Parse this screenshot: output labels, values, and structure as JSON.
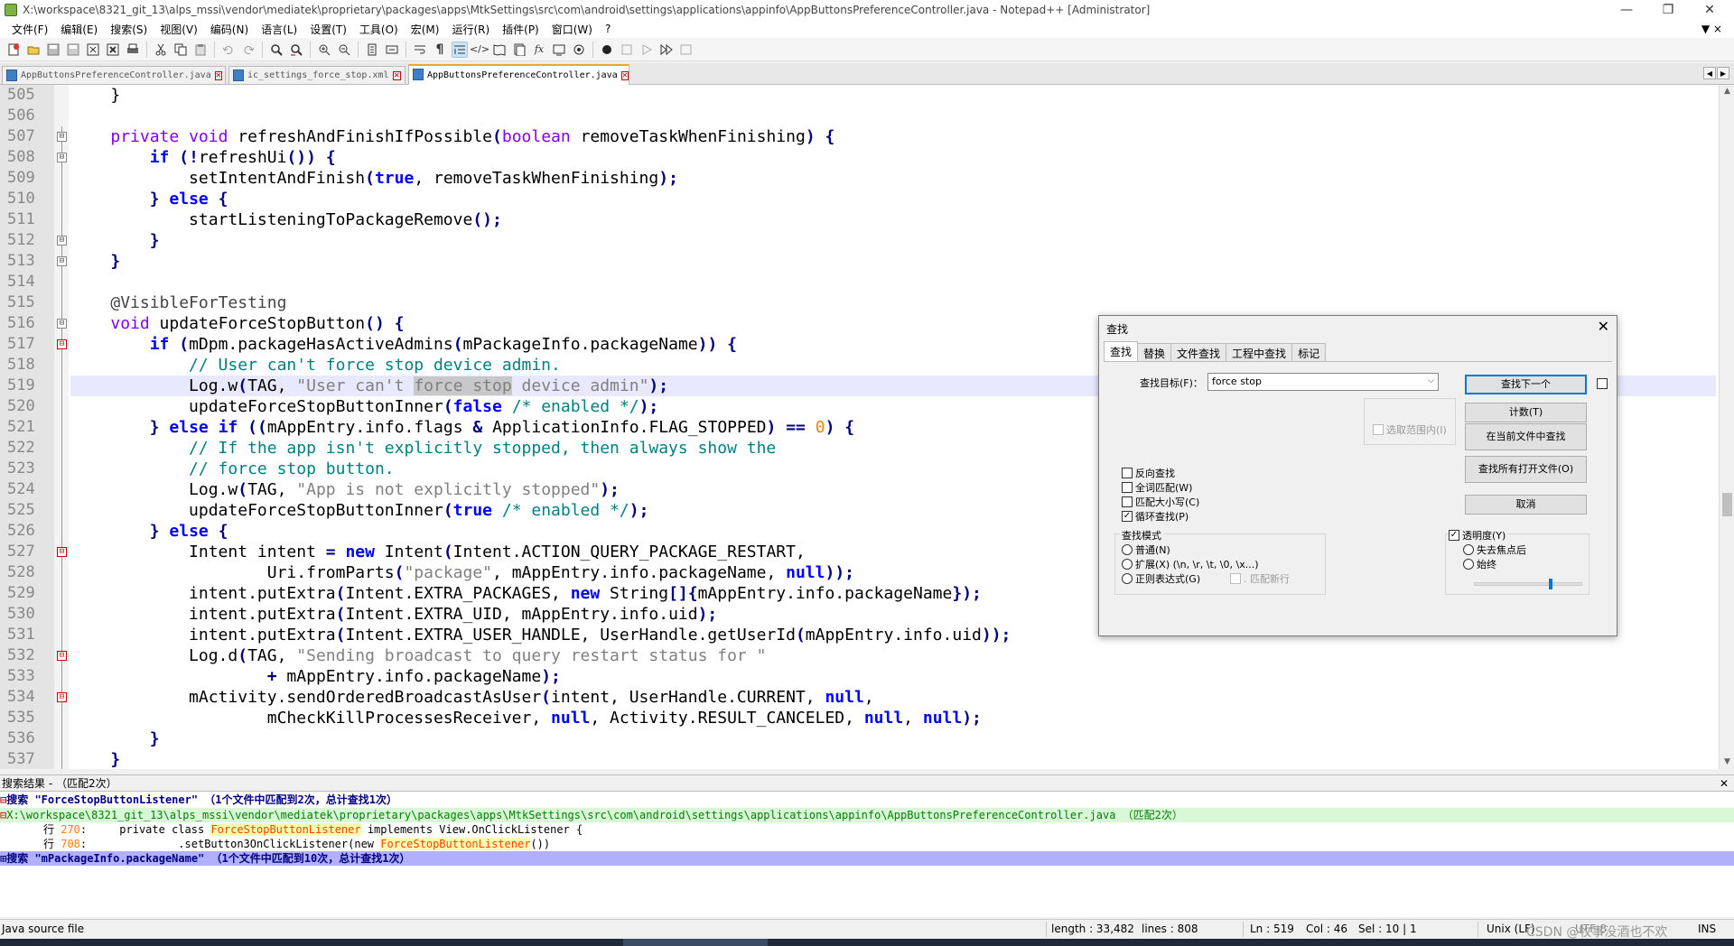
{
  "window": {
    "title": "X:\\workspace\\8321_git_13\\alps_mssi\\vendor\\mediatek\\proprietary\\packages\\apps\\MtkSettings\\src\\com\\android\\settings\\applications\\appinfo\\AppButtonsPreferenceController.java - Notepad++ [Administrator]",
    "min": "—",
    "max": "❐",
    "close": "✕"
  },
  "menu": [
    "文件(F)",
    "编辑(E)",
    "搜索(S)",
    "视图(V)",
    "编码(N)",
    "语言(L)",
    "设置(T)",
    "工具(O)",
    "宏(M)",
    "运行(R)",
    "插件(P)",
    "窗口(W)",
    "?"
  ],
  "menu_right": "▼ ×",
  "tabs": [
    {
      "label": "AppButtonsPreferenceController.java",
      "close": "✕"
    },
    {
      "label": "ic_settings_force_stop.xml",
      "close": "✕"
    },
    {
      "label": "AppButtonsPreferenceController.java",
      "close": "✕"
    }
  ],
  "tabnav": {
    "left": "◀",
    "right": "▶",
    "close": "✕"
  },
  "editor": {
    "lines": [
      {
        "n": "505"
      },
      {
        "n": "506"
      },
      {
        "n": "507"
      },
      {
        "n": "508"
      },
      {
        "n": "509"
      },
      {
        "n": "510"
      },
      {
        "n": "511"
      },
      {
        "n": "512"
      },
      {
        "n": "513"
      },
      {
        "n": "514"
      },
      {
        "n": "515"
      },
      {
        "n": "516"
      },
      {
        "n": "517"
      },
      {
        "n": "518"
      },
      {
        "n": "519"
      },
      {
        "n": "520"
      },
      {
        "n": "521"
      },
      {
        "n": "522"
      },
      {
        "n": "523"
      },
      {
        "n": "524"
      },
      {
        "n": "525"
      },
      {
        "n": "526"
      },
      {
        "n": "527"
      },
      {
        "n": "528"
      },
      {
        "n": "529"
      },
      {
        "n": "530"
      },
      {
        "n": "531"
      },
      {
        "n": "532"
      },
      {
        "n": "533"
      },
      {
        "n": "534"
      },
      {
        "n": "535"
      },
      {
        "n": "536"
      },
      {
        "n": "537"
      }
    ],
    "fold": "⊟"
  },
  "results": {
    "header": "搜索结果 - （匹配2次）",
    "close": "✕",
    "search1": "搜索 \"ForceStopButtonListener\" （1个文件中匹配到2次，总计查找1次）",
    "file1": "X:\\workspace\\8321_git_13\\alps_mssi\\vendor\\mediatek\\proprietary\\packages\\apps\\MtkSettings\\src\\com\\android\\settings\\applications\\appinfo\\AppButtonsPreferenceController.java （匹配2次）",
    "row1_prefix": "行 ",
    "row1_num": "270",
    "row1_a": ":     private class ",
    "row1_match": "ForceStopButtonListener",
    "row1_b": " implements View.OnClickListener {",
    "row2_prefix": "行 ",
    "row2_num": "708",
    "row2_a": ":              .setButton3OnClickListener(new ",
    "row2_match": "ForceStopButtonListener",
    "row2_b": "())",
    "search2": "搜索 \"mPackageInfo.packageName\" （1个文件中匹配到10次，总计查找1次）",
    "minus": "⊟",
    "plus": "⊞"
  },
  "status": {
    "type": "Java source file",
    "length": "length : 33,482",
    "lines": "lines : 808",
    "ln": "Ln : 519",
    "col": "Col : 46",
    "sel": "Sel : 10 | 1",
    "eol": "Unix (LF)",
    "enc": "UTF-8",
    "ins": "INS",
    "watermark": "CSDN @牧事没酒也不欢"
  },
  "dialog": {
    "title": "查找",
    "close": "✕",
    "tabs": [
      "查找",
      "替换",
      "文件查找",
      "工程中查找",
      "标记"
    ],
    "target_label": "查找目标(F)：",
    "target_value": "force stop",
    "dropdown": "⌵",
    "btn_next": "查找下一个",
    "btn_count": "计数(T)",
    "btn_current": "在当前文件中查找",
    "btn_all_open": "查找所有打开文件(O)",
    "btn_cancel": "取消",
    "in_selection": "选取范围内(I)",
    "opts": [
      "反向查找",
      "全词匹配(W)",
      "匹配大小写(C)",
      "循环查找(P)"
    ],
    "mode_title": "查找模式",
    "mode_normal": "普通(N)",
    "mode_ext": "扩展(X) (\\n, \\r, \\t, \\0, \\x...)",
    "mode_regex": "正则表达式(G)",
    "mode_dotnl": ". 匹配新行",
    "trans": "透明度(Y)",
    "trans_lose": "失去焦点后",
    "trans_always": "始终",
    "check": "✓"
  }
}
